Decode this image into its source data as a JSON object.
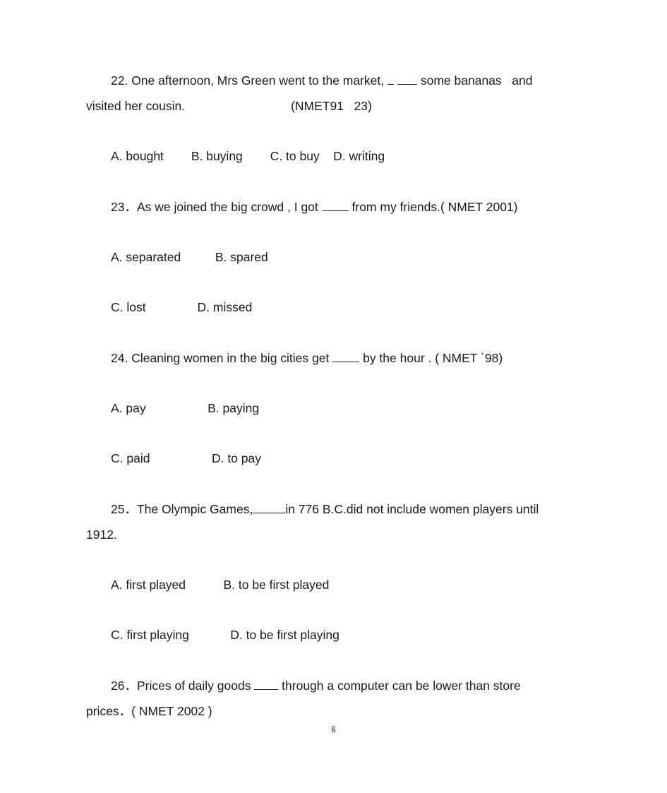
{
  "document": {
    "page_number": "6",
    "text_color": "#1a1a1a",
    "background_color": "#ffffff"
  },
  "questions": [
    {
      "number": "22.",
      "stem_line1_before_blank": "22. One afternoon, Mrs Green went to the market, ",
      "stem_line1_after_blank": " some bananas   and",
      "stem_line2": "visited her cousin.",
      "source_inline": "(NMET91   23)",
      "options_rows": [
        "A. bought        B. buying        C. to buy    D. writing"
      ]
    },
    {
      "number": "23．",
      "stem_before_blank": "23．As we joined the big crowd , I got ",
      "stem_after_blank": " from my friends.( NMET 2001)",
      "options_rows": [
        "A. separated          B. spared",
        "C. lost               D. missed"
      ]
    },
    {
      "number": "24.",
      "stem_before_blank": "24. Cleaning women in the big cities get ",
      "stem_after_blank": " by the hour . ( NMET `98)",
      "options_rows": [
        "A. pay                  B. paying",
        "C. paid                  D. to pay"
      ]
    },
    {
      "number": "25．",
      "stem_line1_before_blank": "25．The Olympic Games,",
      "stem_line1_after_blank": "in 776 B.C.did not include women players until",
      "stem_line2": "1912.",
      "options_rows": [
        "A. first played           B. to be first played",
        "C. first playing            D. to be first playing"
      ]
    },
    {
      "number": "26．",
      "stem_line1_before_blank": "26．Prices of daily goods ",
      "stem_line1_after_blank": " through a computer can be lower than store",
      "stem_line2": "prices．( NMET 2002 )"
    }
  ]
}
